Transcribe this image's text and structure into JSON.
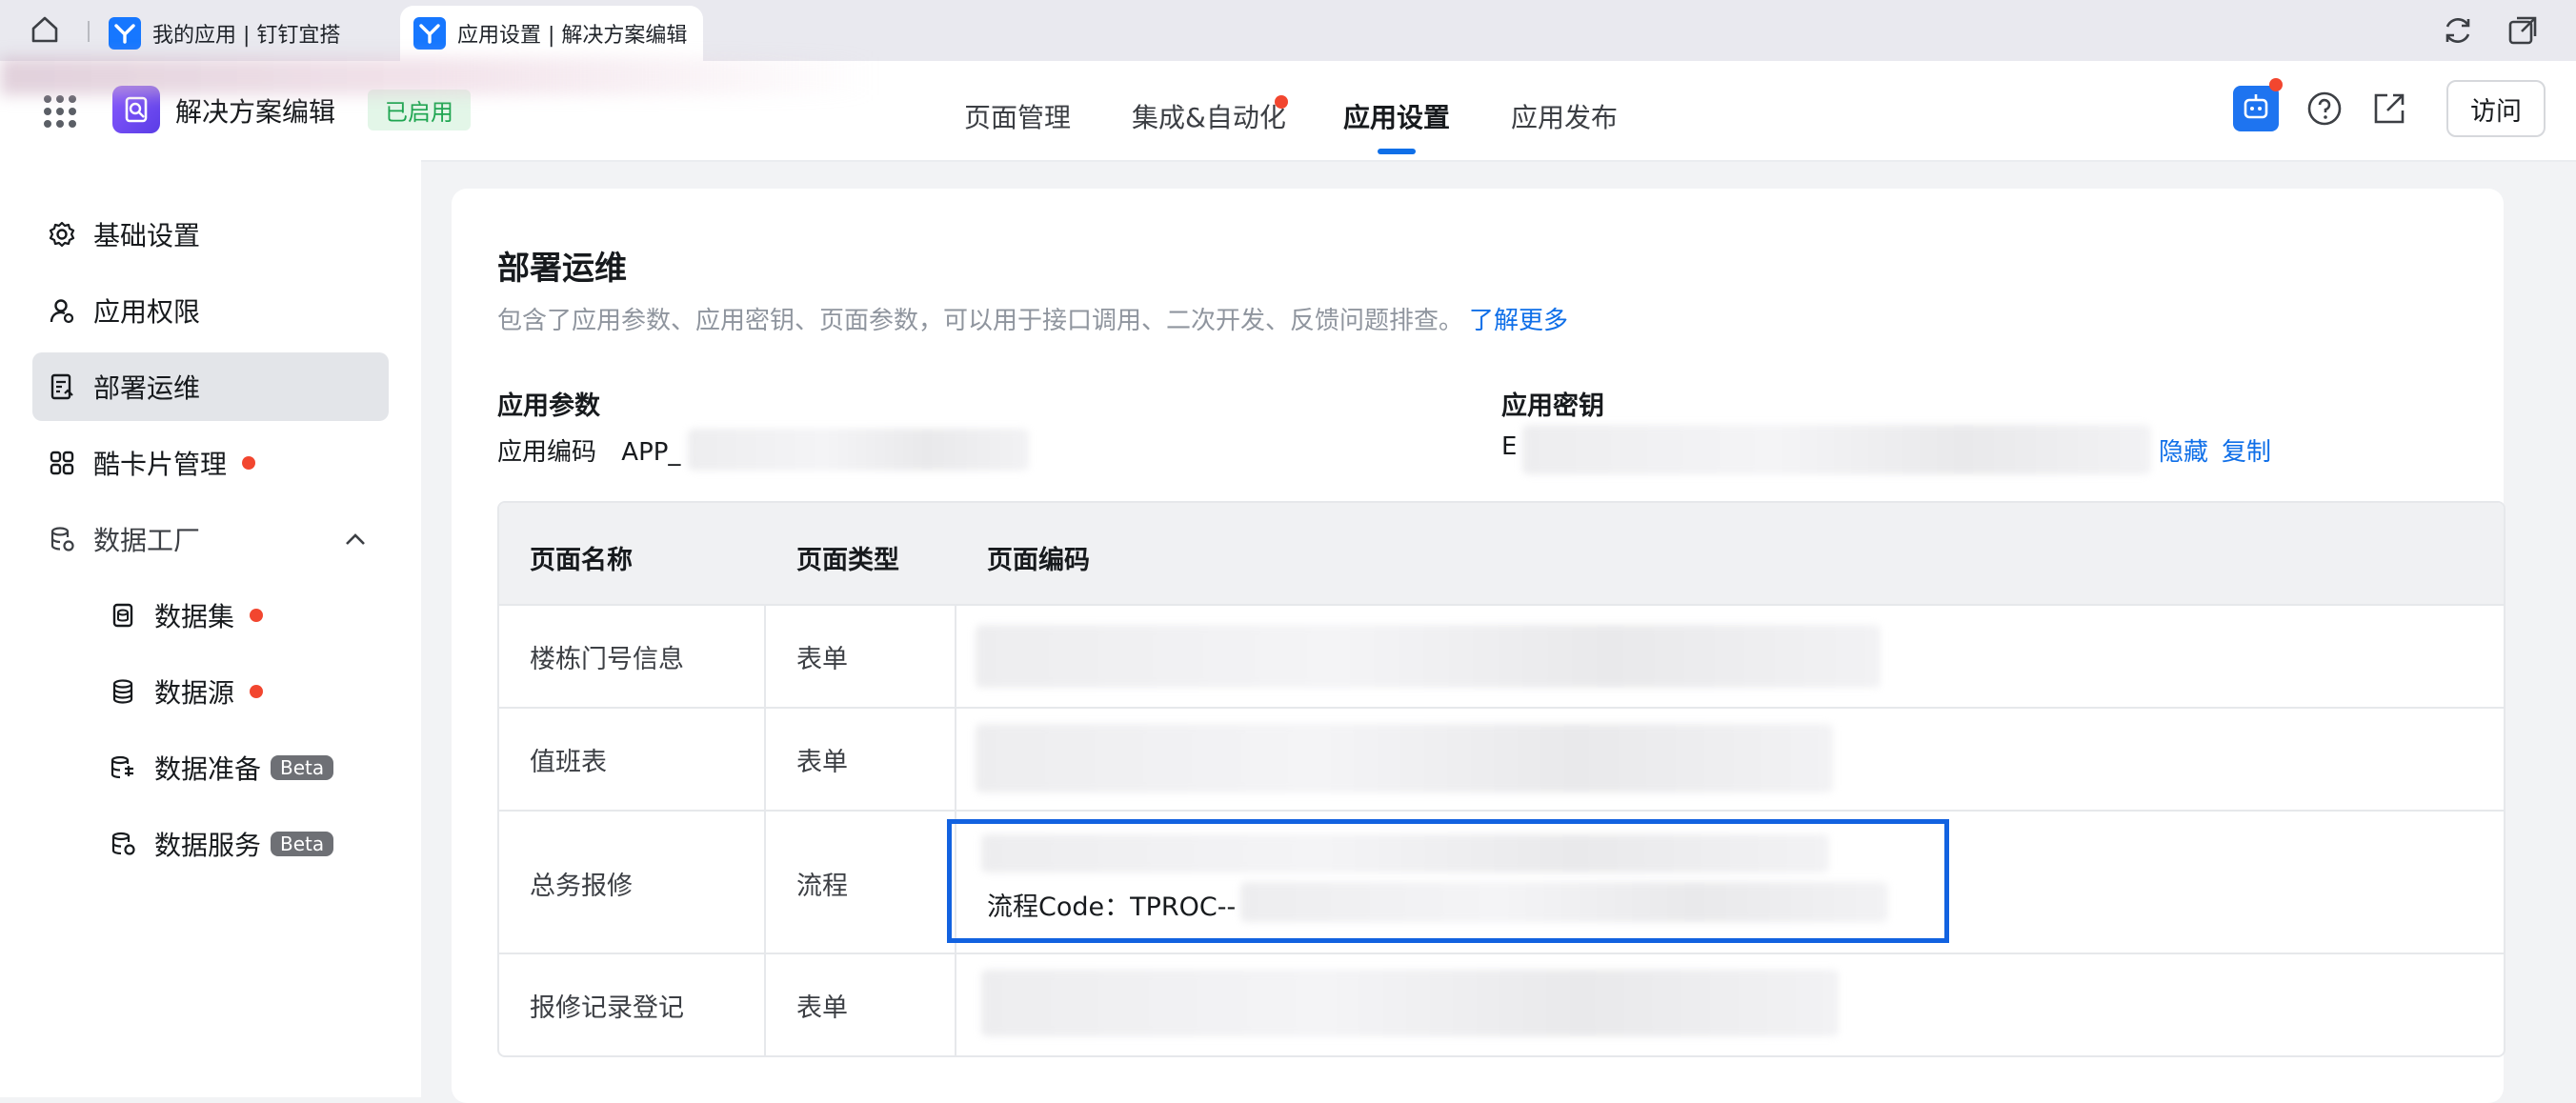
{
  "browser": {
    "tabs": [
      {
        "title": "我的应用 | 钉钉宜搭",
        "active": false
      },
      {
        "title": "应用设置 | 解决方案编辑",
        "active": true
      }
    ],
    "icons": [
      "home-icon",
      "sync-icon",
      "new-window-icon"
    ]
  },
  "header": {
    "app_name": "解决方案编辑",
    "status": "已启用",
    "nav": [
      "页面管理",
      "集成&自动化",
      "应用设置",
      "应用发布"
    ],
    "active_nav": "应用设置",
    "visit_label": "访问",
    "accent_color": "#0f6fe8"
  },
  "sidebar": {
    "items": [
      {
        "label": "基础设置",
        "icon": "gear-icon"
      },
      {
        "label": "应用权限",
        "icon": "user-permission-icon"
      },
      {
        "label": "部署运维",
        "icon": "deploy-icon",
        "active": true
      },
      {
        "label": "酷卡片管理",
        "icon": "cards-icon",
        "dot": true
      },
      {
        "label": "数据工厂",
        "icon": "database-icon",
        "expanded": true
      }
    ],
    "sub_items": [
      {
        "label": "数据集",
        "icon": "dataset-icon",
        "dot": true
      },
      {
        "label": "数据源",
        "icon": "datasource-icon",
        "dot": true
      },
      {
        "label": "数据准备",
        "icon": "data-prep-icon",
        "badge": "Beta"
      },
      {
        "label": "数据服务",
        "icon": "data-service-icon",
        "badge": "Beta"
      }
    ]
  },
  "content": {
    "title": "部署运维",
    "description": "包含了应用参数、应用密钥、页面参数，可以用于接口调用、二次开发、反馈问题排查。",
    "learn_more": "了解更多",
    "app_params_label": "应用参数",
    "app_code_label": "应用编码",
    "app_code_prefix": "APP_",
    "app_secret_label": "应用密钥",
    "app_secret_prefix": "E",
    "hide_label": "隐藏",
    "copy_label": "复制",
    "table": {
      "columns": [
        "页面名称",
        "页面类型",
        "页面编码"
      ],
      "rows": [
        {
          "name": "楼栋门号信息",
          "type": "表单"
        },
        {
          "name": "值班表",
          "type": "表单"
        },
        {
          "name": "总务报修",
          "type": "流程",
          "code_line2": "流程Code：TPROC--"
        },
        {
          "name": "报修记录登记",
          "type": "表单"
        }
      ]
    }
  }
}
